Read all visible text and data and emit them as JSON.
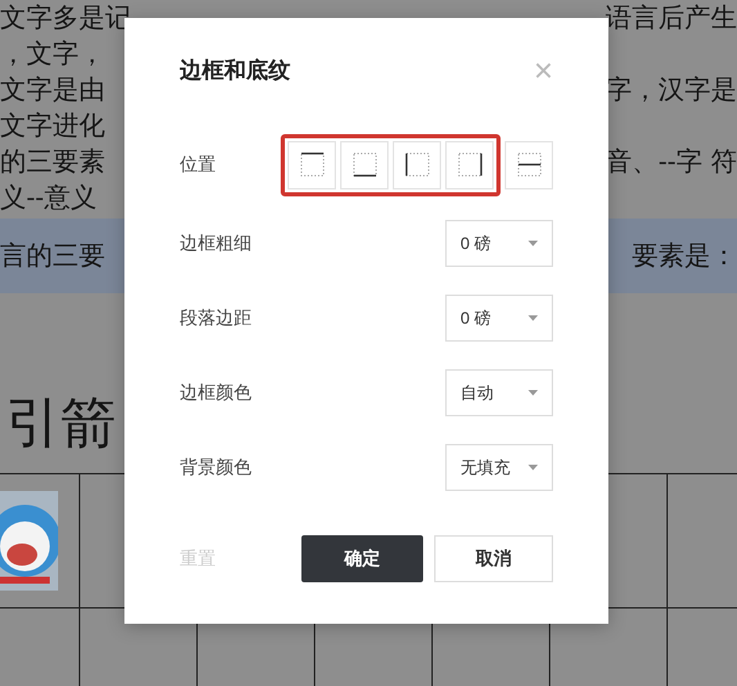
{
  "document": {
    "lines": [
      {
        "left": "文字多是记",
        "right": "语言后产生"
      },
      {
        "left": "，文字，"
      },
      {
        "left": "文字是由",
        "right": "字，汉字是"
      },
      {
        "left": "文字进化"
      },
      {
        "left": "的三要素",
        "right": "音、--字 符"
      },
      {
        "left": "义--意义"
      }
    ],
    "band": {
      "left": "言的三要",
      "right": "要素是："
    },
    "heading": "引箭"
  },
  "dialog": {
    "title": "边框和底纹",
    "close": "×",
    "position": {
      "label": "位置",
      "options": [
        {
          "kind": "top",
          "highlighted": true
        },
        {
          "kind": "bottom",
          "highlighted": true
        },
        {
          "kind": "left",
          "highlighted": true
        },
        {
          "kind": "right",
          "highlighted": true
        },
        {
          "kind": "inner-horizontal",
          "highlighted": false
        }
      ]
    },
    "fields": [
      {
        "label": "边框粗细",
        "value": "0 磅"
      },
      {
        "label": "段落边距",
        "value": "0 磅"
      },
      {
        "label": "边框颜色",
        "value": "自动"
      },
      {
        "label": "背景颜色",
        "value": "无填充"
      }
    ],
    "reset": {
      "label": "重置",
      "disabled": true
    },
    "confirm": "确定",
    "cancel": "取消"
  }
}
